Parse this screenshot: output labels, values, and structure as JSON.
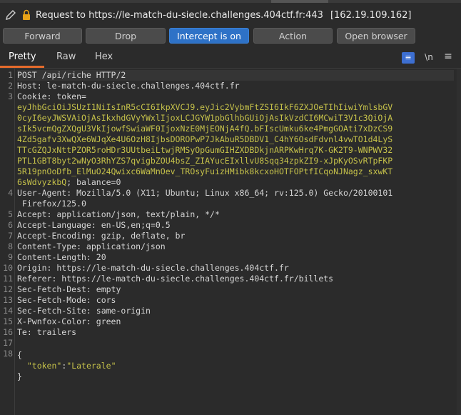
{
  "request_line": {
    "text": "Request to https://le-match-du-siecle.challenges.404ctf.fr:443",
    "ip": "[162.19.109.162]"
  },
  "buttons": {
    "forward": "Forward",
    "drop": "Drop",
    "intercept": "Intercept is on",
    "action": "Action",
    "open_browser": "Open browser"
  },
  "tabs": [
    "Pretty",
    "Raw",
    "Hex"
  ],
  "toolbar": {
    "newline_label": "\\n"
  },
  "lines": {
    "l1": "POST /api/riche HTTP/2",
    "l2": "Host: le-match-du-siecle.challenges.404ctf.fr",
    "l3": "Cookie: token=",
    "cookie": [
      "eyJhbGciOiJSUzI1NiIsInR5cCI6IkpXVCJ9.eyJic2VybmFtZSI6IkF6ZXJOeTIhIiwiYmlsbGV",
      "0cyI6eyJWSVAiOjAsIkxhdGVyYWxlIjoxLCJGYW1pbGlhbGUiOjAsIkVzdCI6MCwiT3V1c3QiOjA",
      "sIk5vcmQgZXQgU3VkIjowfSwiaWF0IjoxNzE0MjEONjA4fQ.bFIscUmku6ke4PmgGOAti7xDzCS9",
      "4Zd5gafv3XwQXe6WJqXe4U6OzH8IjbsDOROPwP7JkAbuR5DBDV1_C4hY6OsdFdvnl4vwTO1d4LyS",
      "TTcGZQJxNttPZOR5roHDr3UUtbeiLtwjRMSyOpGumGIHZXDBDkjnARPKwHrq7K-GK2T9-WNPWV32",
      "PTL1GBT8byt2wNyO3RhYZS7qvigbZOU4bsZ_ZIAYucEIxllvU8Sqq34zpkZI9-xJpKyOSvRTpFKP",
      "5R19pnOoDfb_ElMuO24Qwixc6WaMnOev_TROsyFuizHMibk8kcxoHOTFOPtfICqoNJNagz_sxwKT"
    ],
    "cookie_last": "6sWdvyzkbQ",
    "cookie_tail": "; balance=0",
    "l4a": "User-Agent: Mozilla/5.0 (X11; Ubuntu; Linux x86_64; rv:125.0) Gecko/20100101",
    "l4b": " Firefox/125.0",
    "l5": "Accept: application/json, text/plain, */*",
    "l6": "Accept-Language: en-US,en;q=0.5",
    "l7": "Accept-Encoding: gzip, deflate, br",
    "l8": "Content-Type: application/json",
    "l9": "Content-Length: 20",
    "l10": "Origin: https://le-match-du-siecle.challenges.404ctf.fr",
    "l11": "Referer: https://le-match-du-siecle.challenges.404ctf.fr/billets",
    "l12": "Sec-Fetch-Dest: empty",
    "l13": "Sec-Fetch-Mode: cors",
    "l14": "Sec-Fetch-Site: same-origin",
    "l15": "X-Pwnfox-Color: green",
    "l16": "Te: trailers",
    "l17": "",
    "l18": "{",
    "json_key": "\"token\"",
    "json_colon": ":",
    "json_value": "\"Laterale\"",
    "json_close": "}"
  },
  "line_numbers": [
    "1",
    "2",
    "3",
    "4",
    "5",
    "6",
    "7",
    "8",
    "9",
    "10",
    "11",
    "12",
    "13",
    "14",
    "15",
    "16",
    "17",
    "18"
  ],
  "colors": {
    "accent": "#2e72c7",
    "tab_underline": "#e56b2c",
    "token": "#c6c24a"
  }
}
